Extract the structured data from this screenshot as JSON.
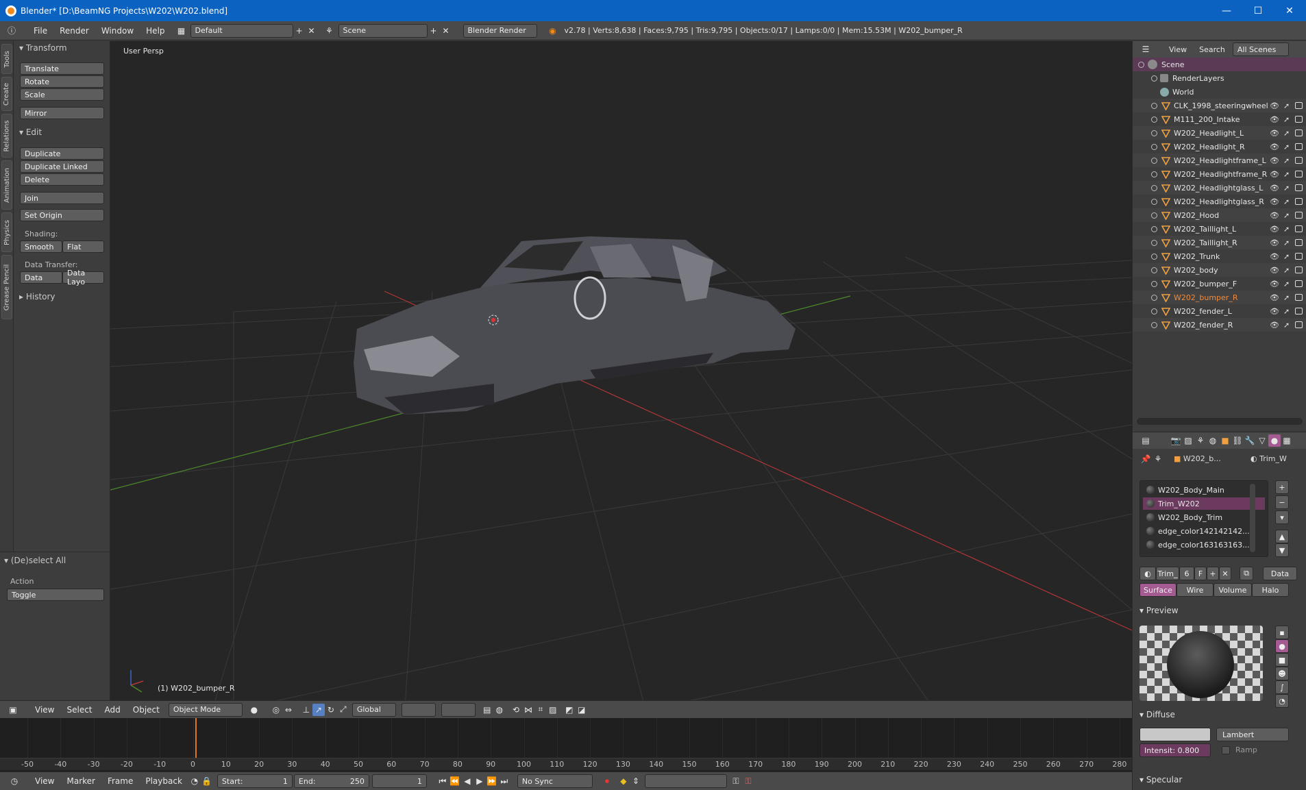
{
  "window": {
    "title": "Blender* [D:\\BeamNG Projects\\W202\\W202.blend]"
  },
  "menubar": {
    "items": [
      "File",
      "Render",
      "Window",
      "Help"
    ],
    "layout": "Default",
    "scene": "Scene",
    "engine": "Blender Render",
    "stats": "v2.78 | Verts:8,638 | Faces:9,795 | Tris:9,795 | Objects:0/17 | Lamps:0/0 | Mem:15.53M | W202_bumper_R"
  },
  "toolshelf": {
    "tabs": [
      "Tools",
      "Create",
      "Relations",
      "Animation",
      "Physics",
      "Grease Pencil"
    ],
    "transform_header": "Transform",
    "transform": [
      "Translate",
      "Rotate",
      "Scale"
    ],
    "mirror": "Mirror",
    "edit_header": "Edit",
    "edit": [
      "Duplicate",
      "Duplicate Linked",
      "Delete"
    ],
    "join": "Join",
    "set_origin": "Set Origin",
    "shading_label": "Shading:",
    "smooth": "Smooth",
    "flat": "Flat",
    "data_transfer_label": "Data Transfer:",
    "data": "Data",
    "data_layout": "Data Layo",
    "history": "History"
  },
  "operator": {
    "title": "(De)select All",
    "action_label": "Action",
    "action_value": "Toggle"
  },
  "viewport": {
    "view_name": "User Persp",
    "active_object": "(1) W202_bumper_R"
  },
  "header3d": {
    "view": "View",
    "select": "Select",
    "add": "Add",
    "object": "Object",
    "mode": "Object Mode",
    "orientation": "Global"
  },
  "timeline": {
    "ticks": [
      "-50",
      "-40",
      "-30",
      "-20",
      "-10",
      "0",
      "10",
      "20",
      "30",
      "40",
      "50",
      "60",
      "70",
      "80",
      "90",
      "100",
      "110",
      "120",
      "130",
      "140",
      "150",
      "160",
      "170",
      "180",
      "190",
      "200",
      "210",
      "220",
      "230",
      "240",
      "250",
      "260",
      "270",
      "280"
    ],
    "current_frame": 0
  },
  "timeline_header": {
    "view": "View",
    "marker": "Marker",
    "frame": "Frame",
    "playback": "Playback",
    "start_label": "Start:",
    "start": "1",
    "end_label": "End:",
    "end": "250",
    "current": "1",
    "sync": "No Sync"
  },
  "outliner": {
    "view": "View",
    "search": "Search",
    "filter": "All Scenes",
    "scene": "Scene",
    "render_layers": "RenderLayers",
    "world": "World",
    "objects": [
      "CLK_1998_steeringwheel",
      "M111_200_Intake",
      "W202_Headlight_L",
      "W202_Headlight_R",
      "W202_Headlightframe_L",
      "W202_Headlightframe_R",
      "W202_Headlightglass_L",
      "W202_Headlightglass_R",
      "W202_Hood",
      "W202_Taillight_L",
      "W202_Taillight_R",
      "W202_Trunk",
      "W202_body",
      "W202_bumper_F",
      "W202_bumper_R",
      "W202_fender_L",
      "W202_fender_R"
    ],
    "active_object": "W202_bumper_R"
  },
  "properties": {
    "breadcrumb_object": "W202_b...",
    "breadcrumb_material": "Trim_W",
    "materials": [
      "W202_Body_Main",
      "Trim_W202",
      "W202_Body_Trim",
      "edge_color142142142...",
      "edge_color163163163..."
    ],
    "selected_material": "Trim_W202",
    "mat_name": "Trim_",
    "users": "6",
    "fake": "F",
    "link": "Data",
    "tabs": [
      "Surface",
      "Wire",
      "Volume",
      "Halo"
    ],
    "preview_header": "Preview",
    "diffuse_header": "Diffuse",
    "diffuse_shader": "Lambert",
    "intensity": "Intensit:  0.800",
    "ramp": "Ramp",
    "specular_header": "Specular"
  },
  "colors": {
    "accent_active": "#a35b92",
    "playhead": "#e07823",
    "axis_x": "#b33636",
    "axis_y": "#4c8a2a"
  }
}
